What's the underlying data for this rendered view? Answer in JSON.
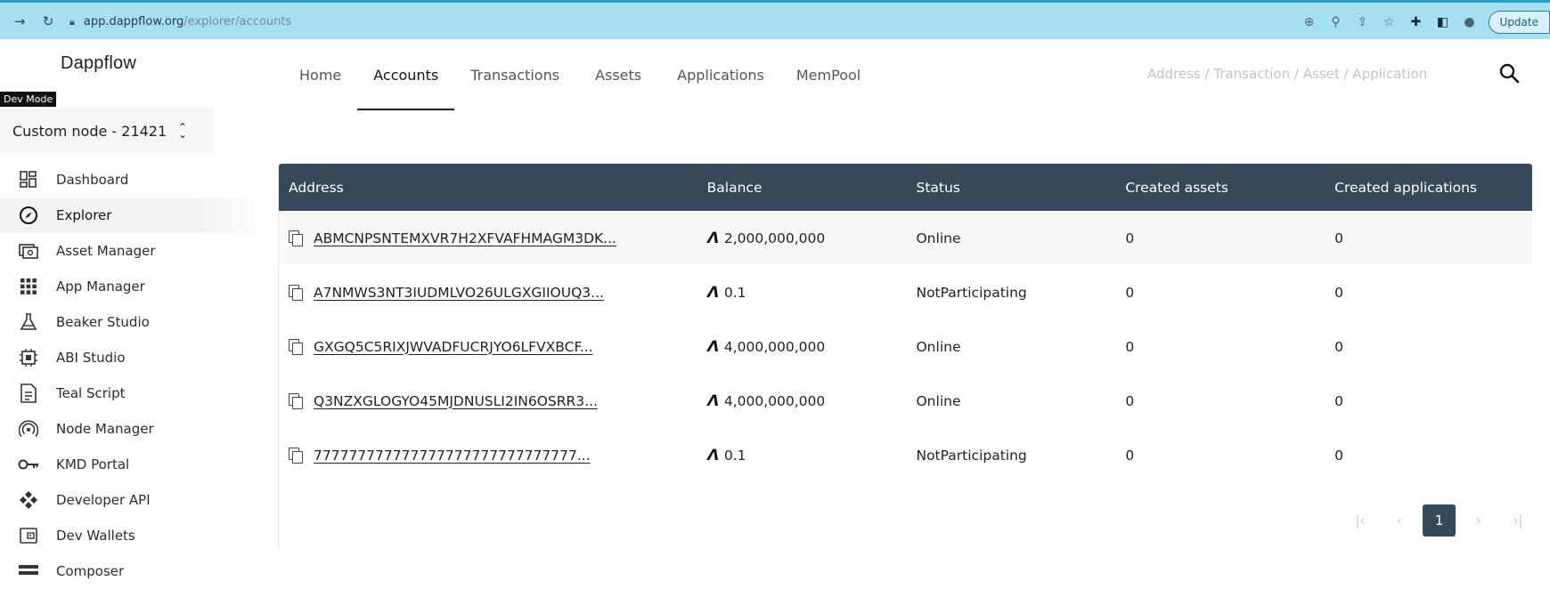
{
  "browser": {
    "url_host": "app.dappflow.org",
    "url_path": "/explorer/accounts",
    "update_label": "Update"
  },
  "sidebar": {
    "logo": "Dappflow",
    "dev_mode_badge": "Dev Mode",
    "node_selector": "Custom node - 21421",
    "items": [
      {
        "label": "Dashboard",
        "icon": "dashboard-icon"
      },
      {
        "label": "Explorer",
        "icon": "compass-icon"
      },
      {
        "label": "Asset Manager",
        "icon": "asset-icon"
      },
      {
        "label": "App Manager",
        "icon": "grid-icon"
      },
      {
        "label": "Beaker Studio",
        "icon": "beaker-icon"
      },
      {
        "label": "ABI Studio",
        "icon": "chip-icon"
      },
      {
        "label": "Teal Script",
        "icon": "document-icon"
      },
      {
        "label": "Node Manager",
        "icon": "signal-icon"
      },
      {
        "label": "KMD Portal",
        "icon": "key-icon"
      },
      {
        "label": "Developer API",
        "icon": "api-icon"
      },
      {
        "label": "Dev Wallets",
        "icon": "wallet-icon"
      },
      {
        "label": "Composer",
        "icon": "composer-icon"
      }
    ]
  },
  "topnav": {
    "tabs": [
      "Home",
      "Accounts",
      "Transactions",
      "Assets",
      "Applications",
      "MemPool"
    ],
    "active_tab": "Accounts",
    "search_placeholder": "Address / Transaction / Asset / Application"
  },
  "table": {
    "columns": [
      "Address",
      "Balance",
      "Status",
      "Created assets",
      "Created applications"
    ],
    "rows": [
      {
        "address": "ABMCNPSNTEMXVR7H2XFVAFHMAGM3DK...",
        "balance": "2,000,000,000",
        "status": "Online",
        "assets": "0",
        "apps": "0"
      },
      {
        "address": "A7NMWS3NT3IUDMLVO26ULGXGIIOUQ3...",
        "balance": "0.1",
        "status": "NotParticipating",
        "assets": "0",
        "apps": "0"
      },
      {
        "address": "GXGQ5C5RIXJWVADFUCRJYO6LFVXBCF...",
        "balance": "4,000,000,000",
        "status": "Online",
        "assets": "0",
        "apps": "0"
      },
      {
        "address": "Q3NZXGLOGYO45MJDNUSLI2IN6OSRR3...",
        "balance": "4,000,000,000",
        "status": "Online",
        "assets": "0",
        "apps": "0"
      },
      {
        "address": "777777777777777777777777777777...",
        "balance": "0.1",
        "status": "NotParticipating",
        "assets": "0",
        "apps": "0"
      }
    ]
  },
  "pagination": {
    "current_page": "1"
  },
  "colors": {
    "table_header": "#36495b",
    "browser_bar": "#a6dff2"
  }
}
